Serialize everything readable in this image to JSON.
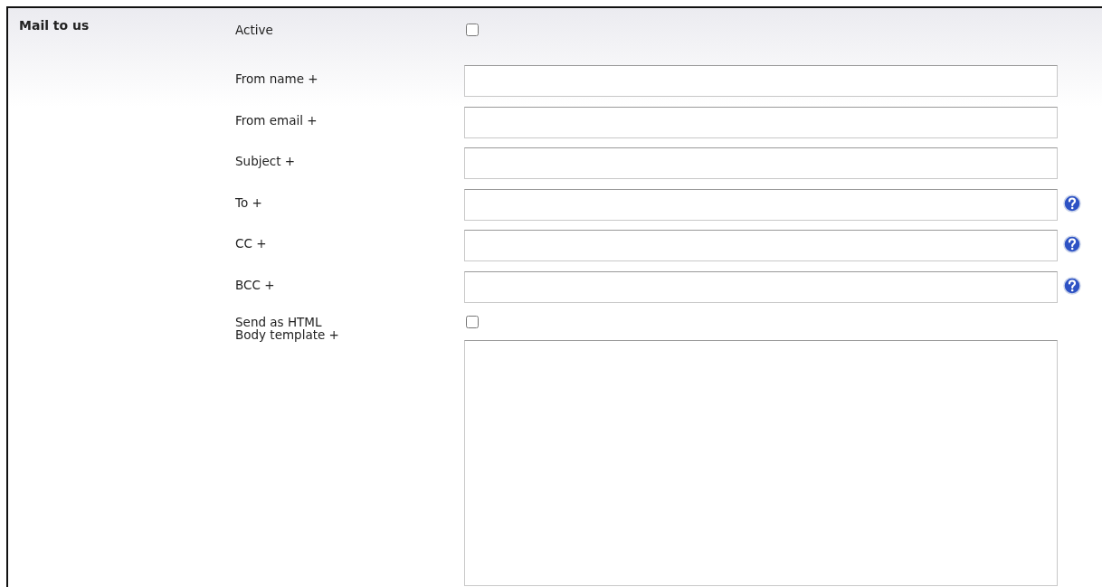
{
  "section": {
    "title": "Mail to us"
  },
  "fields": [
    {
      "kind": "checkbox",
      "label": "Active",
      "checked": false,
      "help": false
    },
    {
      "kind": "text",
      "label": "From name +",
      "help": false
    },
    {
      "kind": "text",
      "label": "From email +",
      "help": false
    },
    {
      "kind": "text",
      "label": "Subject +",
      "help": false
    },
    {
      "kind": "text",
      "label": "To +",
      "help": true
    },
    {
      "kind": "text",
      "label": "CC +",
      "help": true
    },
    {
      "kind": "text",
      "label": "BCC +",
      "help": true
    },
    {
      "kind": "checkbox",
      "label": "Send as HTML",
      "checked": false,
      "help": false
    },
    {
      "kind": "textarea",
      "label": "Body template +",
      "help": false
    }
  ]
}
